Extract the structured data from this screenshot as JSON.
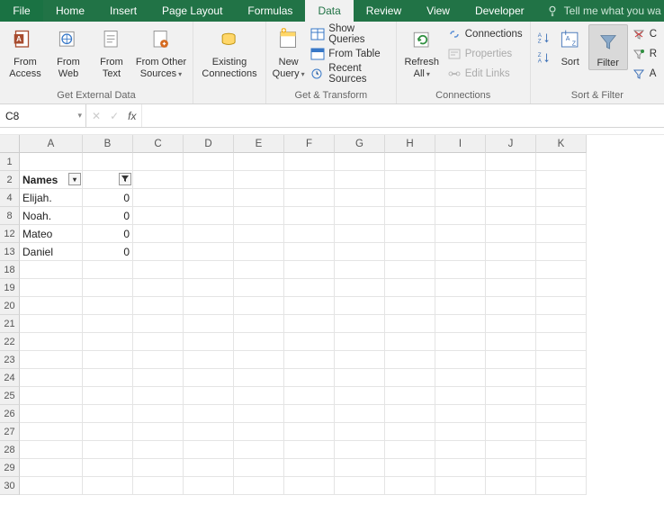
{
  "tabs": {
    "file": "File",
    "items": [
      "Home",
      "Insert",
      "Page Layout",
      "Formulas",
      "Data",
      "Review",
      "View",
      "Developer"
    ],
    "active": "Data",
    "tell_me": "Tell me what you wa"
  },
  "ribbon": {
    "ext_data": {
      "label": "Get External Data",
      "from_access": "From\nAccess",
      "from_web": "From\nWeb",
      "from_text": "From\nText",
      "from_other": "From Other\nSources"
    },
    "existing": {
      "label": "Existing\nConnections"
    },
    "transform": {
      "label": "Get & Transform",
      "new_query": "New\nQuery",
      "show_queries": "Show Queries",
      "from_table": "From Table",
      "recent_sources": "Recent Sources"
    },
    "connections": {
      "label": "Connections",
      "refresh_all": "Refresh\nAll",
      "connections": "Connections",
      "properties": "Properties",
      "edit_links": "Edit Links"
    },
    "sort_filter": {
      "label": "Sort & Filter",
      "sort": "Sort",
      "filter": "Filter",
      "clear": "C",
      "reapply": "R",
      "advanced": "A"
    }
  },
  "namebox": "C8",
  "formula": "",
  "columns": [
    "A",
    "B",
    "C",
    "D",
    "E",
    "F",
    "G",
    "H",
    "I",
    "J",
    "K"
  ],
  "row_numbers": [
    1,
    2,
    4,
    8,
    12,
    13,
    18,
    19,
    20,
    21,
    22,
    23,
    24,
    25,
    26,
    27,
    28,
    29,
    30
  ],
  "header_row": {
    "a": "Names",
    "b": ""
  },
  "data_rows": [
    {
      "a": "Elijah.",
      "b": "0"
    },
    {
      "a": "Noah.",
      "b": "0"
    },
    {
      "a": "Mateo",
      "b": "0"
    },
    {
      "a": "Daniel",
      "b": "0"
    }
  ]
}
